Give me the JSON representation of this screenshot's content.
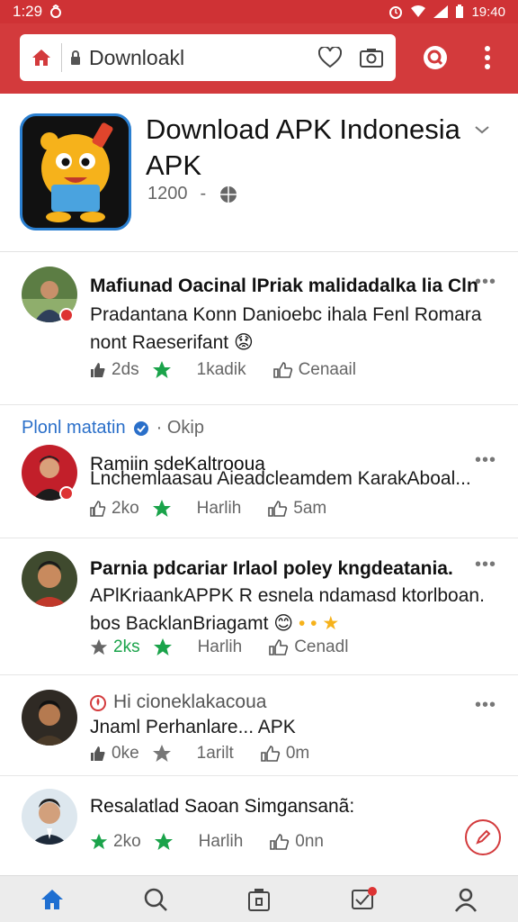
{
  "status_bar": {
    "time": "1:29",
    "right_time": "19:40"
  },
  "browser": {
    "url_text": "Downloakl"
  },
  "app": {
    "title": "Download APK Indonesia APK",
    "count": "1200"
  },
  "posts": [
    {
      "title": "Mafiunad Oacinal lPriak malidadalka lia Cln",
      "body": "Pradantana Konn Danioebc ihala Fenl Romara nont Raeserifant",
      "actions": [
        "2ds",
        "1kadik",
        "Cenaail"
      ]
    },
    {
      "title": "Ramiin sdeKaltrooua",
      "body": "Lnchemlaasau Aieadcleamdem KarakAboal...",
      "actions": [
        "2ko",
        "Harlih",
        "5am"
      ]
    },
    {
      "title": "Parnia pdcariar Irlaol poley kngdeatania.",
      "body": "APlKriaankAPPK R esnela ndamasd ktorlboan. bos BacklanBriagamt",
      "actions": [
        "2ks",
        "Harlih",
        "Cenadl"
      ]
    },
    {
      "title": "Hi cioneklakacoua",
      "body": "Jnaml Perhanlare... APK",
      "actions": [
        "0ke",
        "1arilt",
        "0m"
      ]
    },
    {
      "title": "Resalatlad Saoan Simgansanã:",
      "body": "",
      "actions": [
        "2ko",
        "Harlih",
        "0nn"
      ]
    }
  ],
  "group": {
    "name": "Plonl matatin",
    "sub": "Okip"
  },
  "colors": {
    "brand_red": "#d33a3c",
    "accent_green": "#1aa34a",
    "link_blue": "#2a6fc9"
  },
  "icons": [
    "home-icon",
    "lock-icon",
    "heart-icon",
    "camera-icon",
    "search-icon",
    "more-icon",
    "chevron-down-icon",
    "star-icon",
    "like-icon",
    "comment-icon",
    "edit-icon",
    "notifications-icon",
    "profile-icon"
  ]
}
